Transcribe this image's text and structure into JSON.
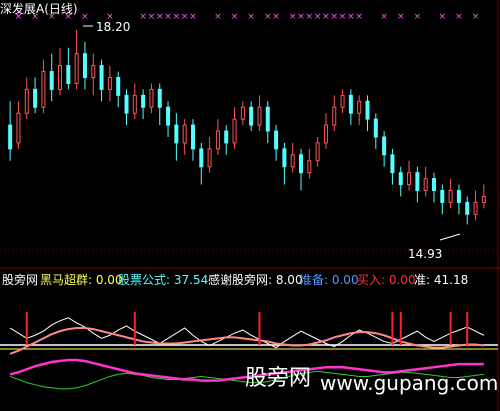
{
  "header": {
    "title": "深发展A(日线)",
    "high_label": "18.20",
    "low_label": "14.93"
  },
  "indicator_bar": {
    "name": "股旁网",
    "items": [
      {
        "label": "黑马超群: 0.00",
        "color": "#ffff55"
      },
      {
        "label": "股票公式: 37.54",
        "color": "#55ffff"
      },
      {
        "label": "感谢股旁网: 8.00",
        "color": "#ffffff"
      },
      {
        "label": "准备: 0.00",
        "color": "#5599ff"
      },
      {
        "label": "买入: 0.00",
        "color": "#ff3333"
      },
      {
        "label": "准: 41.18",
        "color": "#ffffff"
      }
    ]
  },
  "watermark": {
    "cn": "股旁网",
    "url": "www.gupang.com"
  },
  "chart_data": {
    "type": "candlestick",
    "ylim": [
      14.5,
      18.4
    ],
    "candles": [
      [
        16.6,
        16.2,
        17.0,
        16.0
      ],
      [
        16.3,
        16.8,
        17.0,
        16.2
      ],
      [
        16.8,
        17.2,
        17.4,
        16.7
      ],
      [
        17.2,
        16.9,
        17.4,
        16.8
      ],
      [
        16.9,
        17.5,
        17.7,
        16.8
      ],
      [
        17.5,
        17.2,
        17.8,
        17.0
      ],
      [
        17.2,
        17.6,
        17.9,
        17.1
      ],
      [
        17.6,
        17.3,
        17.9,
        17.2
      ],
      [
        17.3,
        17.8,
        18.2,
        17.2
      ],
      [
        17.8,
        17.4,
        18.0,
        17.2
      ],
      [
        17.4,
        17.6,
        17.8,
        17.1
      ],
      [
        17.6,
        17.2,
        17.7,
        17.0
      ],
      [
        17.2,
        17.4,
        17.6,
        17.0
      ],
      [
        17.4,
        17.1,
        17.5,
        16.9
      ],
      [
        17.1,
        16.8,
        17.2,
        16.6
      ],
      [
        16.8,
        17.1,
        17.3,
        16.7
      ],
      [
        17.1,
        16.9,
        17.2,
        16.7
      ],
      [
        16.9,
        17.2,
        17.3,
        16.8
      ],
      [
        17.2,
        16.9,
        17.3,
        16.6
      ],
      [
        16.9,
        16.6,
        17.0,
        16.4
      ],
      [
        16.6,
        16.3,
        16.8,
        16.0
      ],
      [
        16.3,
        16.6,
        16.7,
        16.1
      ],
      [
        16.6,
        16.2,
        16.7,
        16.0
      ],
      [
        16.2,
        15.9,
        16.3,
        15.6
      ],
      [
        15.9,
        16.2,
        16.4,
        15.8
      ],
      [
        16.2,
        16.5,
        16.7,
        16.1
      ],
      [
        16.5,
        16.3,
        16.6,
        16.1
      ],
      [
        16.3,
        16.7,
        16.9,
        16.2
      ],
      [
        16.7,
        16.9,
        17.0,
        16.6
      ],
      [
        16.9,
        16.6,
        17.0,
        16.5
      ],
      [
        16.6,
        16.9,
        17.1,
        16.5
      ],
      [
        16.9,
        16.5,
        17.0,
        16.3
      ],
      [
        16.5,
        16.2,
        16.6,
        16.0
      ],
      [
        16.2,
        15.9,
        16.3,
        15.6
      ],
      [
        15.9,
        16.1,
        16.3,
        15.8
      ],
      [
        16.1,
        15.8,
        16.2,
        15.5
      ],
      [
        15.8,
        16.0,
        16.2,
        15.7
      ],
      [
        16.0,
        16.3,
        16.4,
        15.9
      ],
      [
        16.3,
        16.6,
        16.8,
        16.2
      ],
      [
        16.6,
        16.9,
        17.1,
        16.5
      ],
      [
        16.9,
        17.1,
        17.2,
        16.8
      ],
      [
        17.1,
        16.8,
        17.2,
        16.6
      ],
      [
        16.8,
        17.0,
        17.1,
        16.6
      ],
      [
        17.0,
        16.7,
        17.1,
        16.5
      ],
      [
        16.7,
        16.4,
        16.8,
        16.2
      ],
      [
        16.4,
        16.1,
        16.5,
        15.9
      ],
      [
        16.1,
        15.8,
        16.2,
        15.6
      ],
      [
        15.8,
        15.6,
        15.9,
        15.4
      ],
      [
        15.6,
        15.8,
        16.0,
        15.5
      ],
      [
        15.8,
        15.5,
        15.9,
        15.3
      ],
      [
        15.5,
        15.7,
        15.9,
        15.4
      ],
      [
        15.7,
        15.5,
        15.8,
        15.3
      ],
      [
        15.5,
        15.3,
        15.6,
        15.1
      ],
      [
        15.3,
        15.5,
        15.7,
        15.2
      ],
      [
        15.5,
        15.3,
        15.6,
        15.1
      ],
      [
        15.3,
        15.1,
        15.4,
        14.93
      ],
      [
        15.1,
        15.3,
        15.5,
        15.0
      ],
      [
        15.3,
        15.4,
        15.6,
        15.2
      ]
    ],
    "signals": [
      {
        "index": 1,
        "color": "#ff55ff"
      },
      {
        "index": 3,
        "color": "#ff55ff"
      },
      {
        "index": 5,
        "color": "#ff55ff"
      },
      {
        "index": 7,
        "color": "#ff55ff"
      },
      {
        "index": 9,
        "color": "#ff55ff"
      },
      {
        "index": 12,
        "color": "#ff55ff"
      },
      {
        "index": 16,
        "color": "#ff55ff"
      },
      {
        "index": 17,
        "color": "#ff55ff"
      },
      {
        "index": 18,
        "color": "#ff55ff"
      },
      {
        "index": 19,
        "color": "#ff55ff"
      },
      {
        "index": 20,
        "color": "#ff55ff"
      },
      {
        "index": 21,
        "color": "#ff55ff"
      },
      {
        "index": 22,
        "color": "#ff55ff"
      },
      {
        "index": 25,
        "color": "#ff55ff"
      },
      {
        "index": 27,
        "color": "#ff55ff"
      },
      {
        "index": 29,
        "color": "#ff55ff"
      },
      {
        "index": 31,
        "color": "#ff55ff"
      },
      {
        "index": 32,
        "color": "#ff55ff"
      },
      {
        "index": 34,
        "color": "#ff55ff"
      },
      {
        "index": 35,
        "color": "#ff55ff"
      },
      {
        "index": 36,
        "color": "#ff55ff"
      },
      {
        "index": 37,
        "color": "#ff55ff"
      },
      {
        "index": 38,
        "color": "#ff55ff"
      },
      {
        "index": 39,
        "color": "#ff55ff"
      },
      {
        "index": 40,
        "color": "#ff55ff"
      },
      {
        "index": 41,
        "color": "#ff55ff"
      },
      {
        "index": 42,
        "color": "#ff55ff"
      },
      {
        "index": 45,
        "color": "#ff55ff"
      },
      {
        "index": 47,
        "color": "#ff55ff"
      },
      {
        "index": 49,
        "color": "#ff55ff"
      },
      {
        "index": 52,
        "color": "#ff55ff"
      },
      {
        "index": 54,
        "color": "#ff55ff"
      },
      {
        "index": 56,
        "color": "#ff55ff"
      }
    ],
    "up_color": "#ff5555",
    "down_color": "#55ffff"
  },
  "indicator_data": {
    "white_line": [
      65,
      60,
      55,
      58,
      62,
      68,
      72,
      75,
      70,
      66,
      60,
      55,
      58,
      63,
      67,
      62,
      58,
      54,
      50,
      55,
      60,
      65,
      58,
      52,
      48,
      52,
      56,
      60,
      63,
      58,
      54,
      50,
      46,
      52,
      57,
      62,
      58,
      54,
      50,
      47,
      52,
      58,
      63,
      60,
      56,
      52,
      50,
      54,
      58,
      62,
      56,
      52,
      56,
      60,
      63,
      66,
      62,
      58
    ],
    "pink_line": [
      40,
      43,
      47,
      51,
      55,
      59,
      62,
      64,
      65,
      65,
      64,
      62,
      60,
      58,
      56,
      54,
      52,
      51,
      50,
      50,
      50,
      51,
      52,
      53,
      54,
      55,
      56,
      56,
      55,
      54,
      53,
      52,
      50,
      49,
      48,
      48,
      49,
      51,
      53,
      56,
      58,
      60,
      61,
      61,
      60,
      58,
      55,
      52,
      50,
      48,
      47,
      46,
      46,
      47,
      48,
      49,
      49,
      48
    ],
    "lower_pink": [
      20,
      22,
      25,
      28,
      30,
      32,
      33,
      34,
      34,
      33,
      31,
      29,
      27,
      25,
      23,
      21,
      20,
      19,
      18,
      17,
      16,
      15,
      15,
      14,
      14,
      14,
      15,
      16,
      17,
      18,
      19,
      20,
      21,
      22,
      23,
      24,
      25,
      26,
      27,
      27,
      27,
      26,
      25,
      24,
      23,
      22,
      22,
      23,
      24,
      25,
      26,
      27,
      28,
      29,
      30,
      30,
      30,
      30
    ],
    "green_line": [
      18,
      15,
      12,
      10,
      8,
      7,
      6,
      6,
      7,
      9,
      12,
      15,
      18,
      20,
      21,
      20,
      19,
      17,
      16,
      15,
      15,
      16,
      17,
      18,
      17,
      16,
      15,
      14,
      13,
      12,
      12,
      13,
      15,
      17,
      19,
      21,
      22,
      23,
      22,
      21,
      20,
      19,
      18,
      18,
      19,
      20,
      21,
      22,
      22,
      21,
      20,
      19,
      18,
      17,
      17,
      18,
      19,
      20
    ],
    "red_spikes": [
      2,
      15,
      30,
      46,
      47,
      53,
      55
    ]
  }
}
